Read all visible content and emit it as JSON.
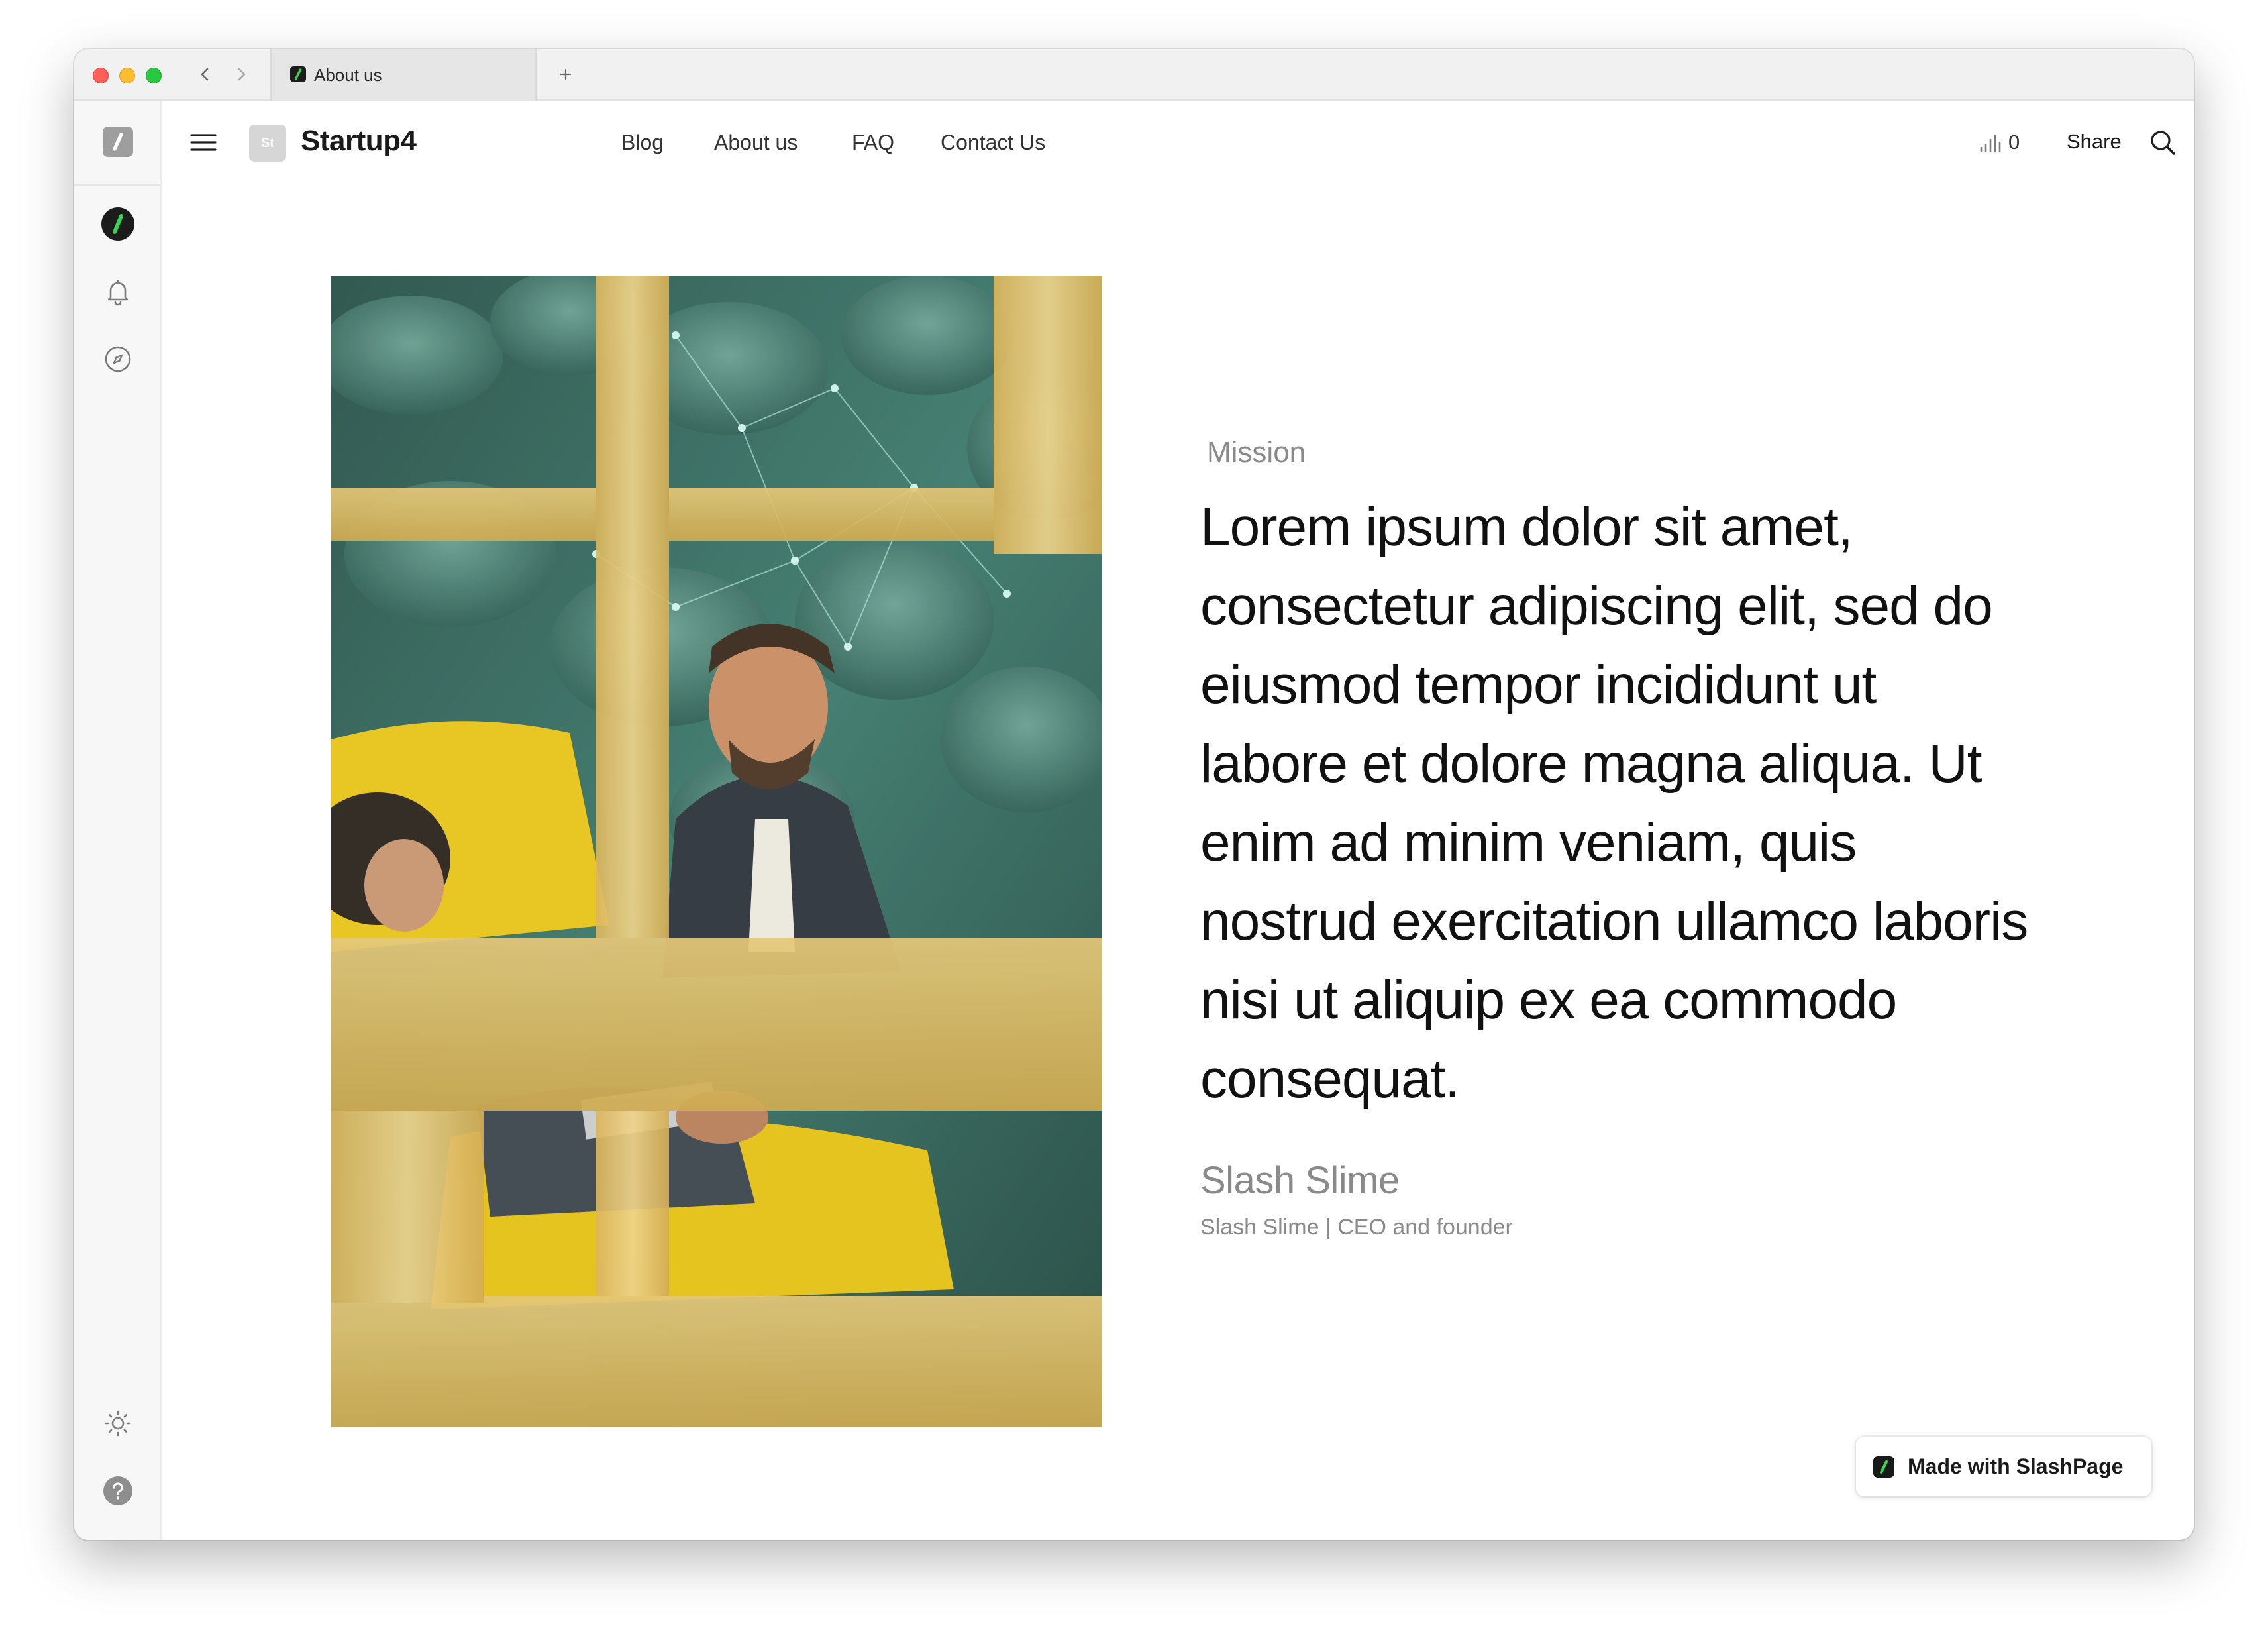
{
  "browser": {
    "tab_title": "About us",
    "new_tab_icon": "plus-icon",
    "back_icon": "chevron-left-icon",
    "forward_icon": "chevron-right-icon"
  },
  "rail": {
    "icons": [
      "slashpage-logo-icon",
      "workspace-avatar-icon",
      "bell-icon",
      "compass-icon",
      "sun-icon",
      "help-icon"
    ]
  },
  "header": {
    "logo_text": "St",
    "site_name": "Startup4",
    "nav": [
      "Blog",
      "About us",
      "FAQ",
      "Contact Us"
    ],
    "views_count": "0",
    "share_label": "Share"
  },
  "content": {
    "eyebrow": "Mission",
    "quote": "Lorem ipsum dolor sit amet, consectetur adipiscing elit, sed do eiusmod tempor incididunt ut labore et dolore magna aliqua. Ut enim ad minim veniam, quis nostrud exercitation ullamco laboris nisi ut aliquip ex ea commodo consequat.",
    "author_name": "Slash Slime",
    "author_role": "Slash Slime | CEO and founder"
  },
  "badge": {
    "label": "Made with SlashPage"
  },
  "colors": {
    "brand_green": "#39d353",
    "traffic_red": "#ff5f57",
    "traffic_yellow": "#febc2e",
    "traffic_green": "#28c840"
  }
}
